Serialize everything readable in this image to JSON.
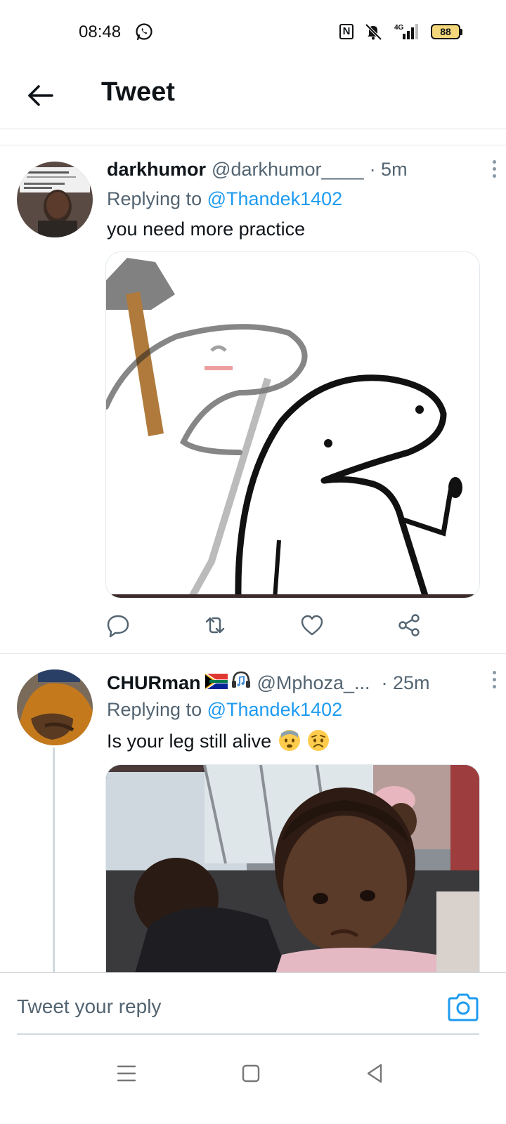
{
  "status_bar": {
    "time": "08:48",
    "network": "4G",
    "battery": "88"
  },
  "header": {
    "title": "Tweet"
  },
  "tweets": [
    {
      "name": "darkhumor",
      "handle": "@darkhumor____",
      "time": "· 5m",
      "replying_prefix": "Replying to",
      "replying_to": "@Thandek1402",
      "text": "you need more practice"
    },
    {
      "name": "CHURman",
      "handle": "@Mphoza_...",
      "time": "· 25m",
      "replying_prefix": "Replying to",
      "replying_to": "@Thandek1402",
      "text": "Is your leg still alive"
    }
  ],
  "reply_bar": {
    "placeholder": "Tweet your reply"
  },
  "colors": {
    "accent": "#1d9bf0",
    "secondary_text": "#536471",
    "primary_text": "#0f1419"
  }
}
